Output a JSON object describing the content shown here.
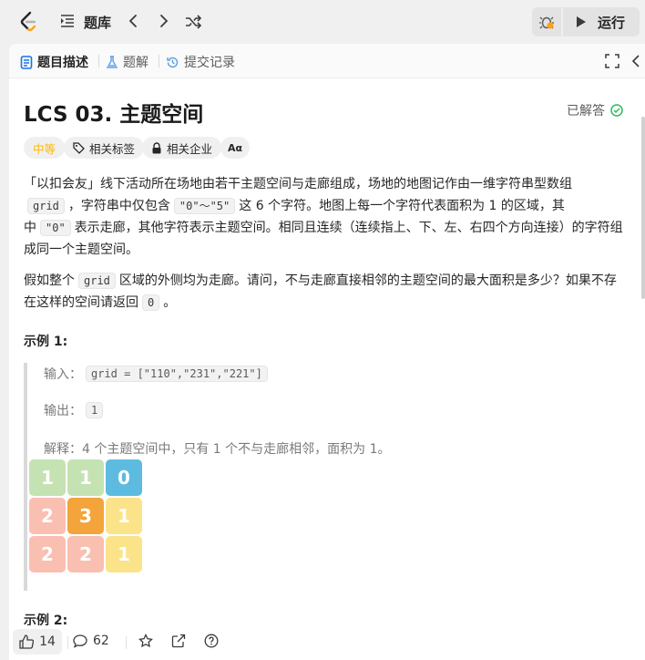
{
  "topbar": {
    "title": "题库",
    "run_label": "运行"
  },
  "tabs": [
    {
      "label": "题目描述",
      "icon": "document-icon"
    },
    {
      "label": "题解",
      "icon": "flask-icon"
    },
    {
      "label": "提交记录",
      "icon": "history-icon"
    }
  ],
  "problem": {
    "title": "LCS 03. 主题空间",
    "status": "已解答",
    "difficulty": "中等",
    "tags": [
      "相关标签",
      "相关企业"
    ],
    "font_toggle": "Aα",
    "desc_1_a": "「以扣会友」线下活动所在场地由若干主题空间与走廊组成，场地的地图记作由一维字符串型数组",
    "desc_1_code_grid": "grid",
    "desc_1_b": "，字符串中仅包含",
    "desc_1_code_range": "\"0\"～\"5\"",
    "desc_1_c": "这 6 个字符。地图上每一个字符代表面积为 1 的区域，其中",
    "desc_1_code_zero": "\"0\"",
    "desc_1_d": "表示走廊，其他字符表示主题空间。相同且连续（连续指上、下、左、右四个方向连接）的字符组成同一个主题空间。",
    "desc_2_a": "假如整个",
    "desc_2_code_grid": "grid",
    "desc_2_b": "区域的外侧均为走廊。请问，不与走廊直接相邻的主题空间的最大面积是多少？如果不存在这样的空间请返回",
    "desc_2_code_zero": "0",
    "desc_2_c": "。",
    "example1_heading": "示例 1:",
    "example1_input_label": "输入：",
    "example1_input": "grid = [\"110\",\"231\",\"221\"]",
    "example1_output_label": "输出：",
    "example1_output": "1",
    "example1_explain": "解释：4 个主题空间中，只有 1 个不与走廊相邻，面积为 1。",
    "example1_grid": [
      [
        "1",
        "1",
        "0"
      ],
      [
        "2",
        "3",
        "1"
      ],
      [
        "2",
        "2",
        "1"
      ]
    ],
    "example2_heading": "示例 2:"
  },
  "colors": {
    "cell_1_top": "#c5e2b3",
    "cell_0": "#5dbbe0",
    "cell_2": "#f9bfb1",
    "cell_3": "#f3a43a",
    "cell_1_right": "#fbe38a",
    "difficulty": "#ffb800",
    "solved": "#2cbb5d"
  },
  "footer": {
    "likes": "14",
    "comments": "62"
  }
}
